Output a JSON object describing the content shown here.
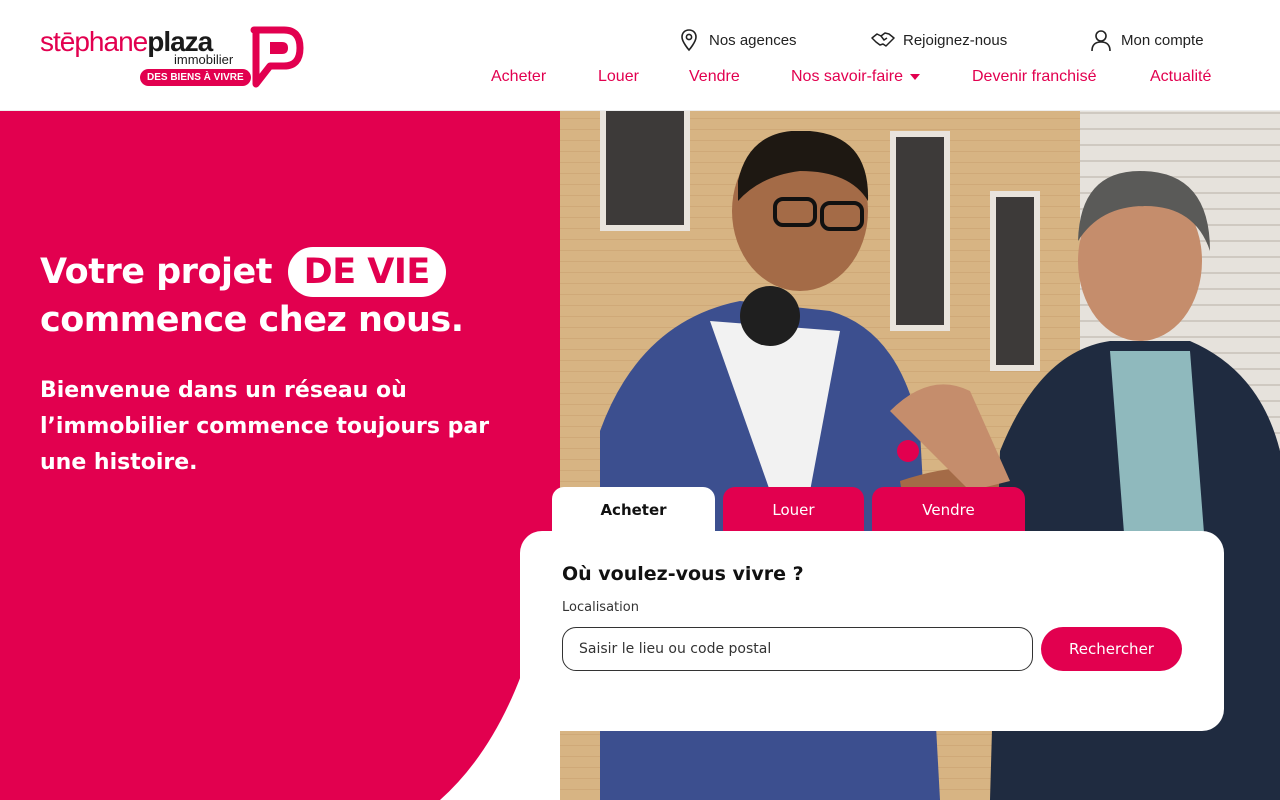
{
  "brand": {
    "name_light": "stēphane",
    "name_bold": "plaza",
    "sub": "immobilier",
    "tagline": "DES BIENS À VIVRE",
    "color": "#e2004f"
  },
  "utility_nav": {
    "agences": {
      "label": "Nos agences",
      "icon": "location-pin-icon"
    },
    "join": {
      "label": "Rejoignez-nous",
      "icon": "handshake-icon"
    },
    "account": {
      "label": "Mon compte",
      "icon": "user-icon"
    }
  },
  "main_nav": [
    {
      "label": "Acheter"
    },
    {
      "label": "Louer"
    },
    {
      "label": "Vendre"
    },
    {
      "label": "Nos savoir-faire",
      "has_dropdown": true
    },
    {
      "label": "Devenir franchisé"
    },
    {
      "label": "Actualité"
    }
  ],
  "hero": {
    "headline_part1": "Votre projet",
    "headline_tag": "DE VIE",
    "headline_part2": "commence chez nous.",
    "subline": "Bienvenue dans un réseau où l’immobilier commence toujours par une histoire."
  },
  "search": {
    "tabs": [
      {
        "label": "Acheter",
        "active": true
      },
      {
        "label": "Louer",
        "active": false
      },
      {
        "label": "Vendre",
        "active": false
      }
    ],
    "question": "Où voulez-vous vivre ?",
    "field_label": "Localisation",
    "placeholder": "Saisir le lieu ou code postal",
    "value": "",
    "submit_label": "Rechercher"
  },
  "colors": {
    "accent": "#e2004f",
    "text_dark": "#111111",
    "white": "#ffffff"
  }
}
